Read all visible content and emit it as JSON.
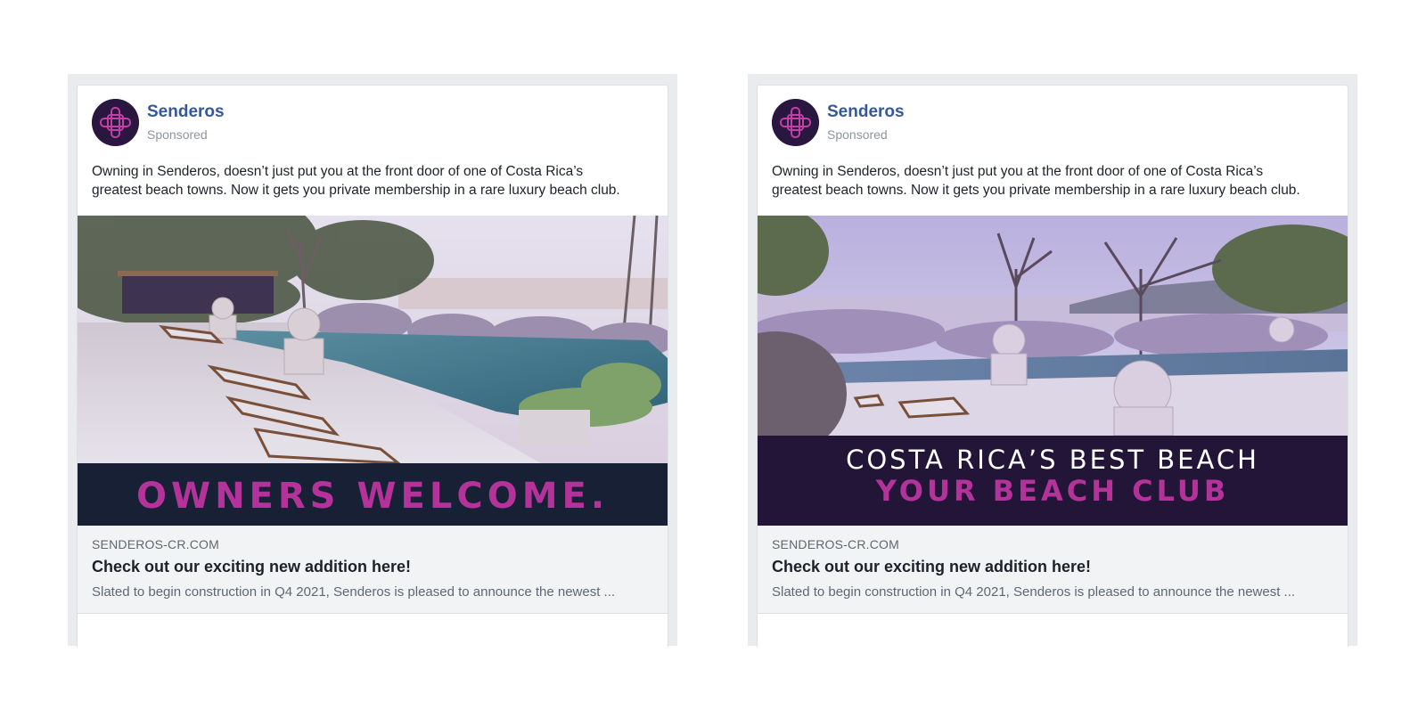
{
  "colors": {
    "page_name": "#365899",
    "accent_magenta": "#b4339a",
    "banner_navy": "#172034",
    "banner_purple": "#231538"
  },
  "ads": [
    {
      "page_name": "Senderos",
      "sponsored_label": "Sponsored",
      "body_line1": "Owning in Senderos, doesn’t just put you at the front door of one of Costa Rica’s",
      "body_line2": "greatest beach towns. Now it gets you private membership in a rare luxury beach club.",
      "banner_line1": "OWNERS WELCOME.",
      "domain": "SENDEROS-CR.COM",
      "headline": "Check out our exciting new addition here!",
      "description": "Slated to begin construction in Q4 2021, Senderos is pleased to announce the newest ..."
    },
    {
      "page_name": "Senderos",
      "sponsored_label": "Sponsored",
      "body_line1": "Owning in Senderos, doesn’t just put you at the front door of one of Costa Rica’s",
      "body_line2": "greatest beach towns. Now it gets you private membership in a rare luxury beach club.",
      "banner_line1": "COSTA RICA’S BEST BEACH",
      "banner_line2": "YOUR BEACH CLUB",
      "domain": "SENDEROS-CR.COM",
      "headline": "Check out our exciting new addition here!",
      "description": "Slated to begin construction in Q4 2021, Senderos is pleased to announce the newest ..."
    }
  ]
}
